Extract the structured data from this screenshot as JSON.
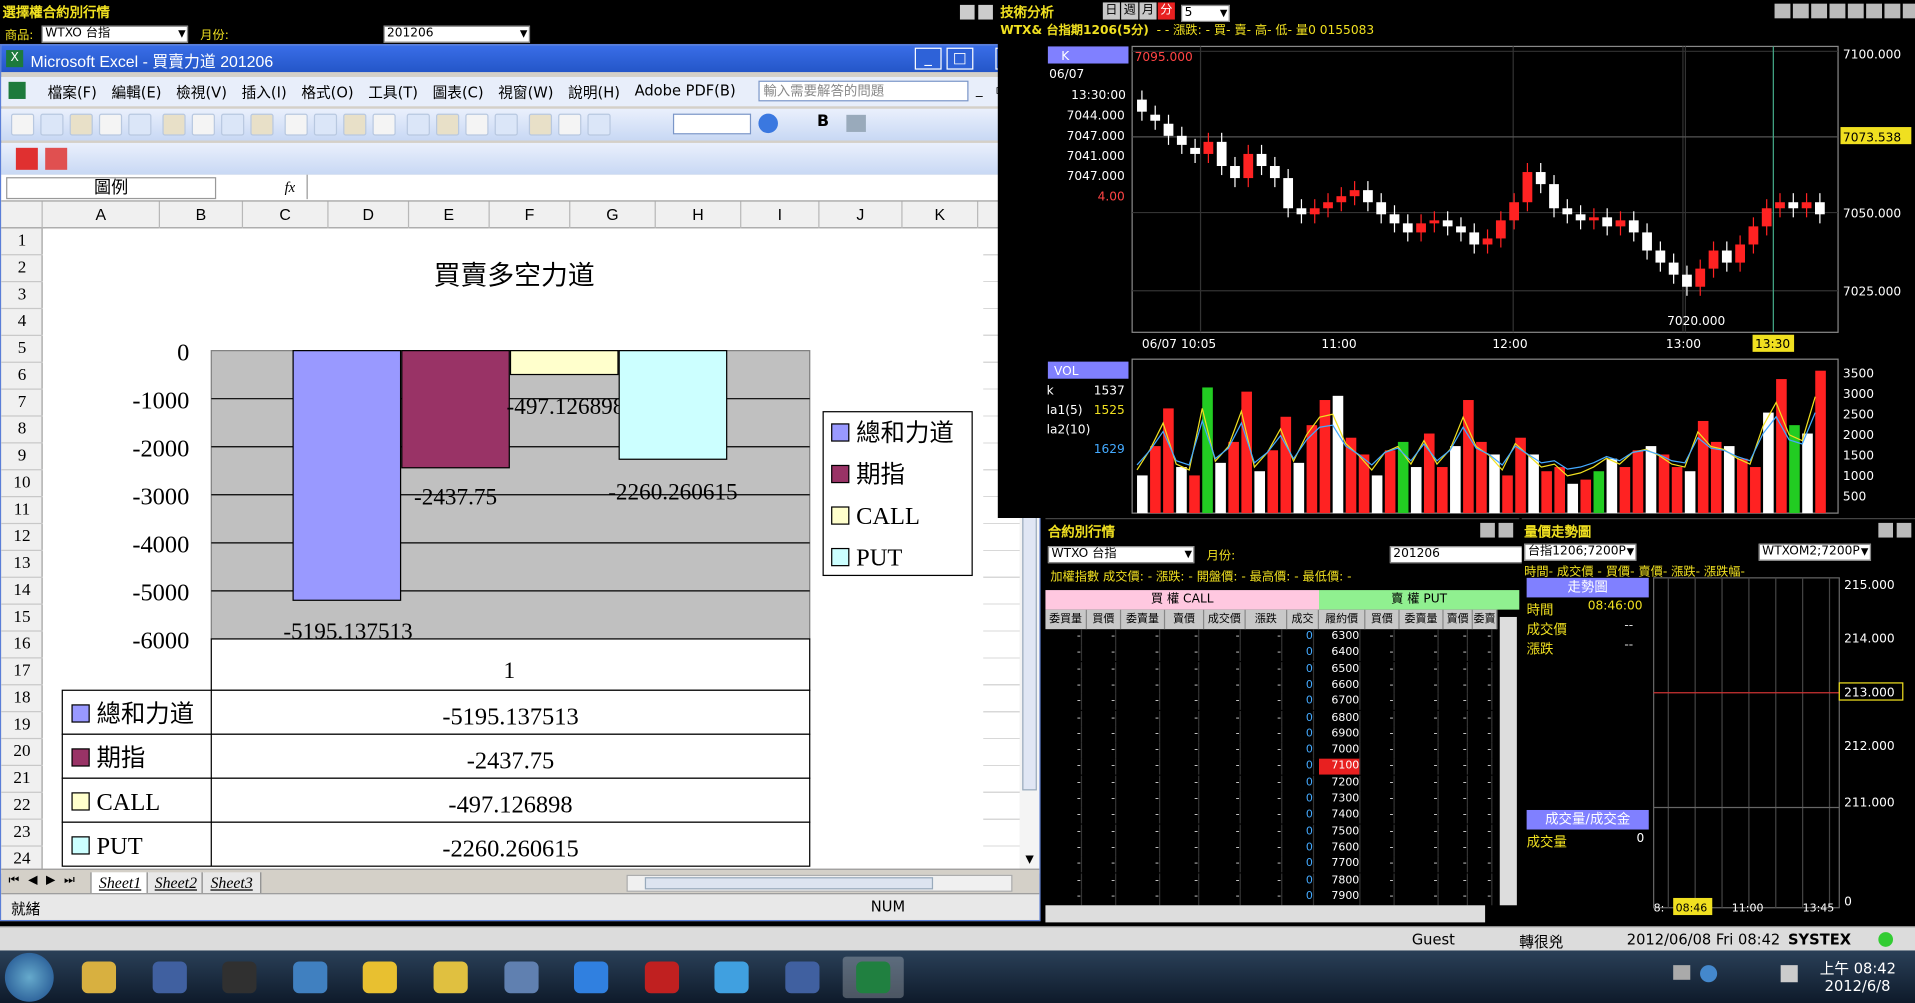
{
  "options_window": {
    "title": "選擇權合約別行情",
    "product_label": "商品:",
    "product_value": "WTXO 台指",
    "month_label": "月份:",
    "month_value": "201206"
  },
  "excel": {
    "title": "Microsoft Excel - 買賣力道 201206",
    "menus": [
      "檔案(F)",
      "編輯(E)",
      "檢視(V)",
      "插入(I)",
      "格式(O)",
      "工具(T)",
      "圖表(C)",
      "視窗(W)",
      "說明(H)",
      "Adobe PDF(B)"
    ],
    "help_placeholder": "輸入需要解答的問題",
    "name_box": "圖例",
    "fx": "fx",
    "columns": [
      "A",
      "B",
      "C",
      "D",
      "E",
      "F",
      "G",
      "H",
      "I",
      "J",
      "K"
    ],
    "rows": [
      "1",
      "2",
      "3",
      "4",
      "5",
      "6",
      "7",
      "8",
      "9",
      "10",
      "11",
      "12",
      "13",
      "14",
      "15",
      "16",
      "17",
      "18",
      "19",
      "20",
      "21",
      "22",
      "23",
      "24"
    ],
    "sheets": [
      "Sheet1",
      "Sheet2",
      "Sheet3"
    ],
    "status_ready": "就緒",
    "status_num": "NUM",
    "bold_label": "B"
  },
  "chart_data": {
    "type": "bar",
    "title": "買賣多空力道",
    "categories": [
      "1"
    ],
    "series": [
      {
        "name": "總和力道",
        "values": [
          -5195.137513
        ],
        "color": "#9999ff"
      },
      {
        "name": "期指",
        "values": [
          -2437.75
        ],
        "color": "#993366"
      },
      {
        "name": "CALL",
        "values": [
          -497.126898
        ],
        "color": "#ffffcc"
      },
      {
        "name": "PUT",
        "values": [
          -2260.260615
        ],
        "color": "#ccffff"
      }
    ],
    "data_labels": [
      "-5195.137513",
      "-2437.75",
      "-497.126898",
      "-2260.260615"
    ],
    "y_ticks": [
      "0",
      "-1000",
      "-2000",
      "-3000",
      "-4000",
      "-5000",
      "-6000"
    ],
    "ylim": [
      -6000,
      0
    ],
    "legend_position": "right",
    "data_table": true
  },
  "tech": {
    "title": "技術分析",
    "periods": [
      "日",
      "週",
      "月",
      "分"
    ],
    "period_value": "5",
    "subtitle": "WTX& 台指期1206(5分)",
    "fields": "- - 漲跌: - 買- 賣- 高- 低- 量0 0155083",
    "k_label": "K",
    "date": "06/07",
    "time": "13:30:00",
    "values": [
      "7044.000",
      "7047.000",
      "7041.000",
      "7047.000",
      "4.00"
    ],
    "top_price": "7095.000",
    "price_axis": [
      "7100.000",
      "7073.538",
      "7050.000",
      "7025.000"
    ],
    "low_label": "7020.000",
    "time_axis": [
      "06/07 10:05",
      "11:00",
      "12:00",
      "13:00",
      "13:30"
    ],
    "vol_label": "VOL",
    "vol_values": [
      "1537",
      "1525",
      "1629"
    ],
    "vol_names": [
      "k",
      "la1(5)",
      "la2(10)"
    ],
    "vol_axis": [
      "3500",
      "3000",
      "2500",
      "2000",
      "1500",
      "1000",
      "500"
    ]
  },
  "option_table": {
    "title": "合約別行情",
    "product_value": "WTXO 台指",
    "month_label": "月份:",
    "month_value": "201206",
    "info": "加權指數 成交價: - 漲跌: - 開盤價: - 最高價: - 最低價: -",
    "call_label": "買 權 CALL",
    "put_label": "賣 權 PUT",
    "headers": [
      "委買量",
      "買價",
      "委賣量",
      "賣價",
      "成交價",
      "漲跌",
      "成交量",
      "履約價",
      "買價",
      "委賣量",
      "賣價",
      "委賣量"
    ],
    "strikes": [
      "6300",
      "6400",
      "6500",
      "6600",
      "6700",
      "6800",
      "6900",
      "7000",
      "7100",
      "7200",
      "7300",
      "7400",
      "7500",
      "7600",
      "7700",
      "7800",
      "7900"
    ],
    "zero": "0",
    "dash": "-"
  },
  "trend": {
    "title": "量價走勢圖",
    "dropdown1": "台指1206;7200P",
    "dropdown2": "WTXOM2;7200P",
    "fields": "時間- 成交價 - 買價- 賣價- 漲跌- 漲跌幅-",
    "panel_title": "走勢圖",
    "time_label": "時間",
    "time_value": "08:46:00",
    "price_label": "成交價",
    "change_label": "漲跌",
    "dash": "--",
    "axis": [
      "215.000",
      "214.000",
      "213.000",
      "212.000",
      "211.000"
    ],
    "vol_title": "成交量/成交金",
    "vol_label": "成交量",
    "vol_value": "0",
    "time_axis": [
      "8:",
      "08:46",
      "11:00",
      "13:45"
    ],
    "axis_zero": "0"
  },
  "statusbar": {
    "user": "Guest",
    "status": "轉很兇",
    "datetime": "2012/06/08 Fri 08:42",
    "brand": "SYSTEX"
  },
  "taskbar": {
    "time": "上午 08:42",
    "date": "2012/6/8"
  }
}
